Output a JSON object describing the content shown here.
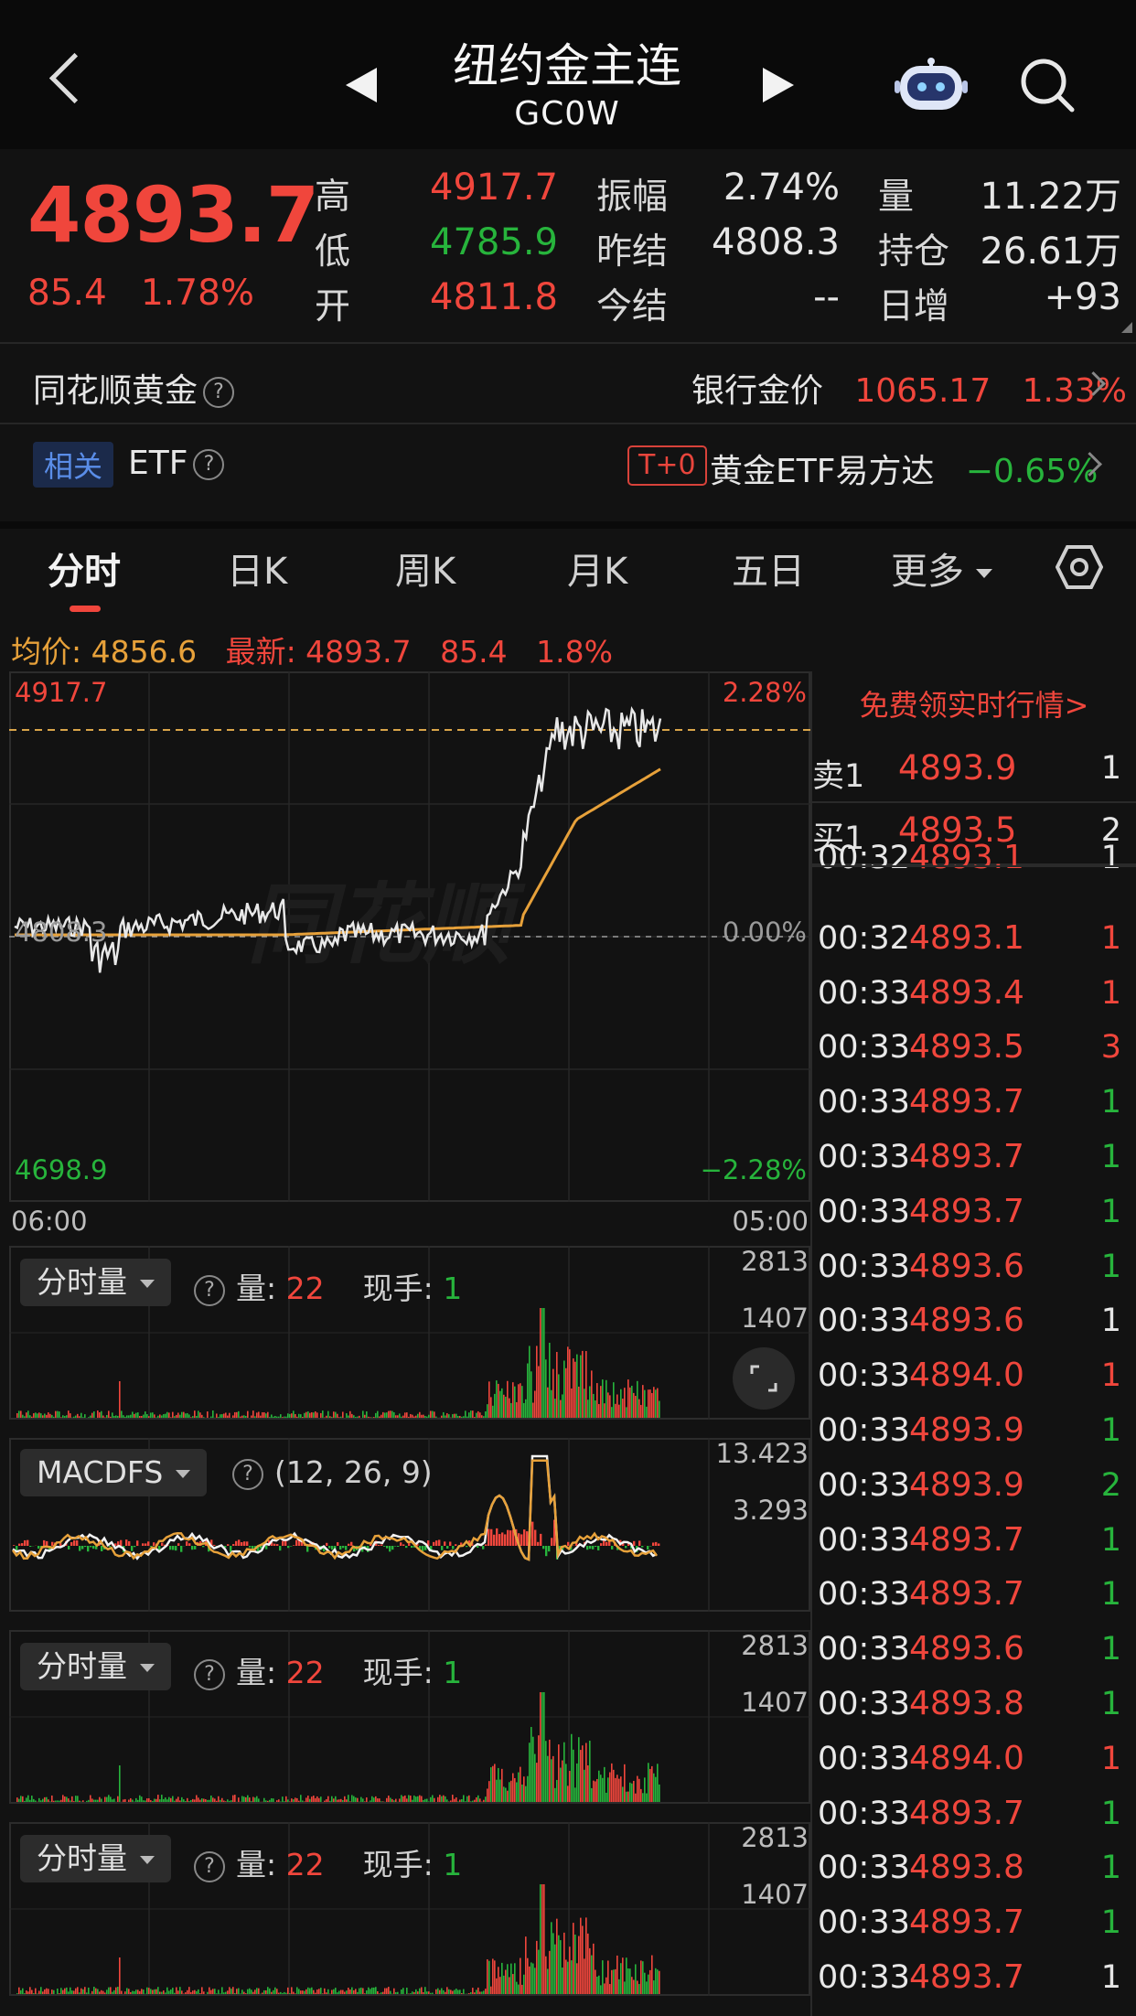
{
  "header": {
    "title": "纽约金主连",
    "code": "GC0W"
  },
  "quote": {
    "price": "4893.7",
    "change": "85.4",
    "change_pct": "1.78%",
    "labels": {
      "high": "高",
      "low": "低",
      "open": "开",
      "amplitude": "振幅",
      "prev_settle": "昨结",
      "settle": "今结",
      "volume": "量",
      "open_interest": "持仓",
      "daily_increase": "日增"
    },
    "high": "4917.7",
    "low": "4785.9",
    "open": "4811.8",
    "amplitude": "2.74%",
    "prev_settle": "4808.3",
    "settle": "--",
    "volume": "11.22万",
    "open_interest": "26.61万",
    "daily_increase": "+93"
  },
  "links": {
    "ths_gold": "同花顺黄金",
    "bank_gold_label": "银行金价",
    "bank_gold_price": "1065.17",
    "bank_gold_pct": "1.33%",
    "related_badge": "相关",
    "etf_label": "ETF",
    "t0_badge": "T+0",
    "etf_name": "黄金ETF易方达",
    "etf_pct": "−0.65%"
  },
  "tabs": {
    "t1": "分时",
    "t2": "日K",
    "t3": "周K",
    "t4": "月K",
    "t5": "五日",
    "t6": "更多"
  },
  "chart_info": {
    "avg_label": "均价: 4856.6",
    "latest_label": "最新: 4893.7",
    "change": "85.4",
    "pct": "1.8%"
  },
  "main_chart": {
    "ymax_label": "4917.7",
    "ymin_label": "4698.9",
    "ref_label": "4808.3",
    "pct_top": "2.28%",
    "pct_zero": "0.00%",
    "pct_bottom": "−2.28%",
    "x_start": "06:00",
    "x_end": "05:00"
  },
  "vol_panel": {
    "select": "分时量",
    "vol_label": "量:",
    "vol_value": "22",
    "hand_label": "现手:",
    "hand_value": "1",
    "axis_top": "2813",
    "axis_mid": "1407"
  },
  "macd_panel": {
    "select": "MACDFS",
    "params": "(12, 26, 9)",
    "axis_top": "13.423",
    "axis_mid": "3.293"
  },
  "right_panel": {
    "promo": "免费领实时行情>",
    "ask_label": "卖1",
    "ask_price": "4893.9",
    "ask_qty": "1",
    "bid_label": "买1",
    "bid_price": "4893.5",
    "bid_qty": "2"
  },
  "ticks": [
    {
      "time": "00:32",
      "price": "4893.1",
      "vol": "1"
    },
    {
      "time": "00:32",
      "price": "4893.1",
      "vol": "1"
    },
    {
      "time": "00:33",
      "price": "4893.4",
      "vol": "1"
    },
    {
      "time": "00:33",
      "price": "4893.5",
      "vol": "3"
    },
    {
      "time": "00:33",
      "price": "4893.7",
      "vol": "1"
    },
    {
      "time": "00:33",
      "price": "4893.7",
      "vol": "1"
    },
    {
      "time": "00:33",
      "price": "4893.7",
      "vol": "1"
    },
    {
      "time": "00:33",
      "price": "4893.6",
      "vol": "1"
    },
    {
      "time": "00:33",
      "price": "4893.6",
      "vol": "1"
    },
    {
      "time": "00:33",
      "price": "4894.0",
      "vol": "1"
    },
    {
      "time": "00:33",
      "price": "4893.9",
      "vol": "1"
    },
    {
      "time": "00:33",
      "price": "4893.9",
      "vol": "2"
    },
    {
      "time": "00:33",
      "price": "4893.7",
      "vol": "1"
    },
    {
      "time": "00:33",
      "price": "4893.7",
      "vol": "1"
    },
    {
      "time": "00:33",
      "price": "4893.6",
      "vol": "1"
    },
    {
      "time": "00:33",
      "price": "4893.8",
      "vol": "1"
    },
    {
      "time": "00:33",
      "price": "4894.0",
      "vol": "1"
    },
    {
      "time": "00:33",
      "price": "4893.7",
      "vol": "1"
    },
    {
      "time": "00:33",
      "price": "4893.8",
      "vol": "1"
    },
    {
      "time": "00:33",
      "price": "4893.7",
      "vol": "1"
    },
    {
      "time": "00:33",
      "price": "4893.7",
      "vol": "1"
    }
  ],
  "tick_colors": [
    "white",
    "red",
    "red",
    "red",
    "green",
    "green",
    "green",
    "green",
    "white",
    "red",
    "green",
    "green",
    "green",
    "green",
    "green",
    "green",
    "red",
    "green",
    "green",
    "green",
    "white"
  ],
  "colors": {
    "up": "#f0463c",
    "down": "#27b43c",
    "avg": "#e7a13a",
    "price_line": "#e8e8e8",
    "background": "#121212"
  }
}
